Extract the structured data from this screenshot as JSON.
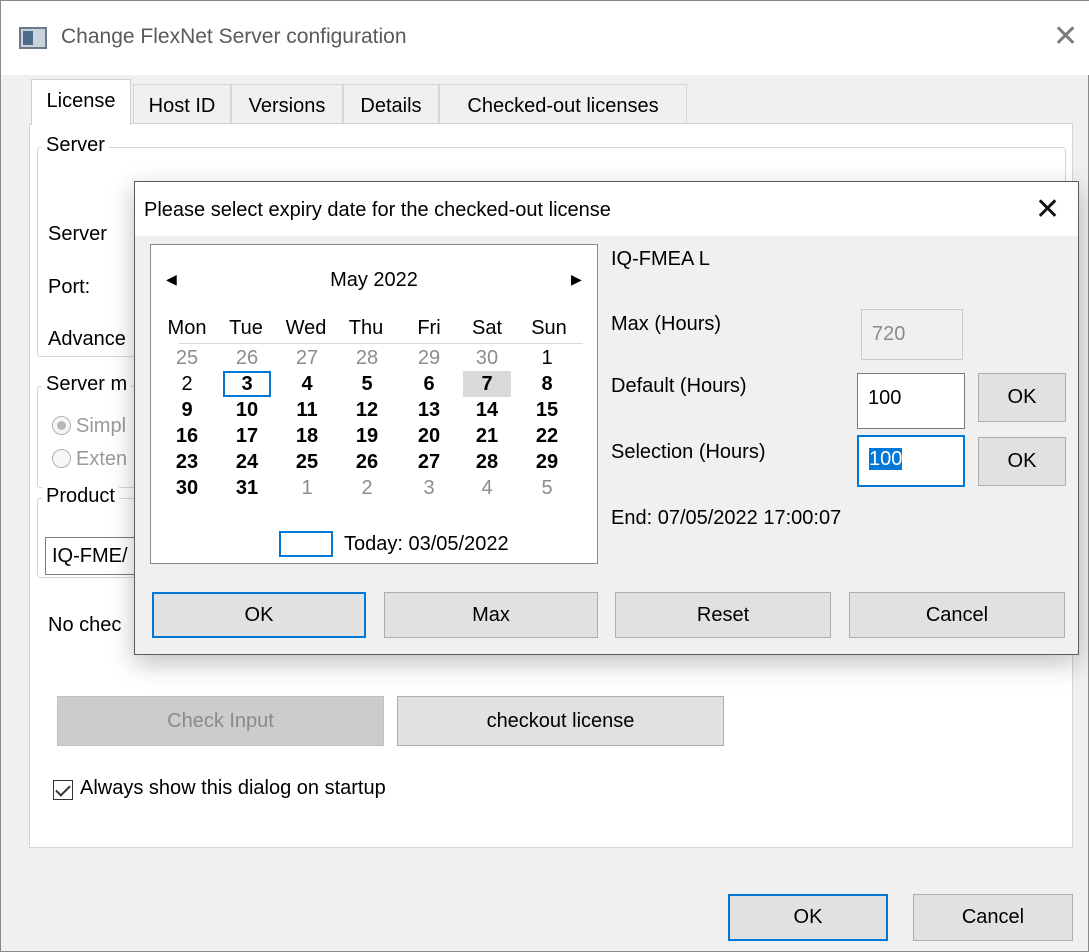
{
  "main": {
    "title": "Change FlexNet Server configuration",
    "close_glyph": "✕",
    "tabs": [
      {
        "label": "License"
      },
      {
        "label": "Host ID"
      },
      {
        "label": "Versions"
      },
      {
        "label": "Details"
      },
      {
        "label": "Checked-out licenses"
      }
    ],
    "server_group": {
      "label": "Server",
      "server_label": "Server",
      "port_label": "Port:",
      "advanced_label": "Advance"
    },
    "server_mode_group": {
      "label": "Server m",
      "simple_label": "Simpl",
      "extended_label": "Exten"
    },
    "product_group": {
      "label": "Product",
      "value": "IQ-FME/"
    },
    "status_text": "No chec",
    "check_input_label": "Check Input",
    "checkout_license_label": "checkout license",
    "always_show_label": "Always show this dialog on startup",
    "ok_label": "OK",
    "cancel_label": "Cancel"
  },
  "dialog": {
    "title": "Please select expiry date for the checked-out license",
    "close_glyph": "✕",
    "calendar": {
      "month": "May 2022",
      "prev_glyph": "◀",
      "next_glyph": "▶",
      "weekdays": [
        "Mon",
        "Tue",
        "Wed",
        "Thu",
        "Fri",
        "Sat",
        "Sun"
      ],
      "weeks": [
        [
          "25",
          "26",
          "27",
          "28",
          "29",
          "30",
          "1"
        ],
        [
          "2",
          "3",
          "4",
          "5",
          "6",
          "7",
          "8"
        ],
        [
          "9",
          "10",
          "11",
          "12",
          "13",
          "14",
          "15"
        ],
        [
          "16",
          "17",
          "18",
          "19",
          "20",
          "21",
          "22"
        ],
        [
          "23",
          "24",
          "25",
          "26",
          "27",
          "28",
          "29"
        ],
        [
          "30",
          "31",
          "1",
          "2",
          "3",
          "4",
          "5"
        ]
      ],
      "today_text": "Today: 03/05/2022"
    },
    "product": "IQ-FMEA L",
    "max_label": "Max (Hours)",
    "max_value": "720",
    "default_label": "Default (Hours)",
    "default_value": "100",
    "selection_label": "Selection (Hours)",
    "selection_value": "100",
    "default_ok_label": "OK",
    "selection_ok_label": "OK",
    "end_text": "End: 07/05/2022 17:00:07",
    "buttons": {
      "ok": "OK",
      "max": "Max",
      "reset": "Reset",
      "cancel": "Cancel"
    }
  }
}
